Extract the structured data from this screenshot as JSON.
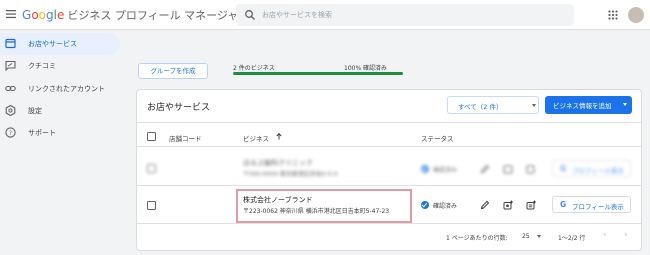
{
  "app": {
    "logo_letters": [
      "G",
      "o",
      "o",
      "g",
      "l",
      "e"
    ],
    "title": "ビジネス プロフィール マネージャ"
  },
  "search": {
    "placeholder": "お店やサービスを検索"
  },
  "sidebar": {
    "items": [
      {
        "label": "お店やサービス",
        "icon": "storefront-icon",
        "active": true
      },
      {
        "label": "クチコミ",
        "icon": "review-icon",
        "active": false
      },
      {
        "label": "リンクされたアカウント",
        "icon": "link-icon",
        "active": false
      },
      {
        "label": "設定",
        "icon": "gear-icon",
        "active": false
      },
      {
        "label": "サポート",
        "icon": "help-icon",
        "active": false
      }
    ]
  },
  "toolbar": {
    "create_group_label": "グループを作成",
    "business_count_label": "2 件のビジネス",
    "verified_label": "100% 確認済み",
    "verified_fraction": 1.0
  },
  "card": {
    "title": "お店やサービス",
    "filter_label": "すべて（2 件）",
    "add_button_label": "ビジネス情報を追加",
    "columns": {
      "store_code": "店舗コード",
      "business": "ビジネス",
      "status": "ステータス"
    },
    "rows": [
      {
        "name": "ほるぷ歯科クリニック",
        "address": "〒000-0000 東京都港区赤坂0-0-0",
        "status": "確認済み",
        "action_label": "プロフィール表示",
        "blurred": true
      },
      {
        "name": "株式会社ノーブランド",
        "address": "〒223-0062 神奈川県 横浜市港北区日吉本町5-47-23",
        "status": "確認済み",
        "action_label": "プロフィール表示",
        "blurred": false
      }
    ],
    "footer": {
      "rows_per_page_label": "1 ページあたりの行数:",
      "rows_per_page_value": "25",
      "range_label": "1〜2/2 行"
    }
  },
  "colors": {
    "accent": "#1a73e8",
    "progress": "#1e8e3e",
    "highlight_border": "#e39aa0",
    "active_nav_bg": "#e8f0fe"
  }
}
